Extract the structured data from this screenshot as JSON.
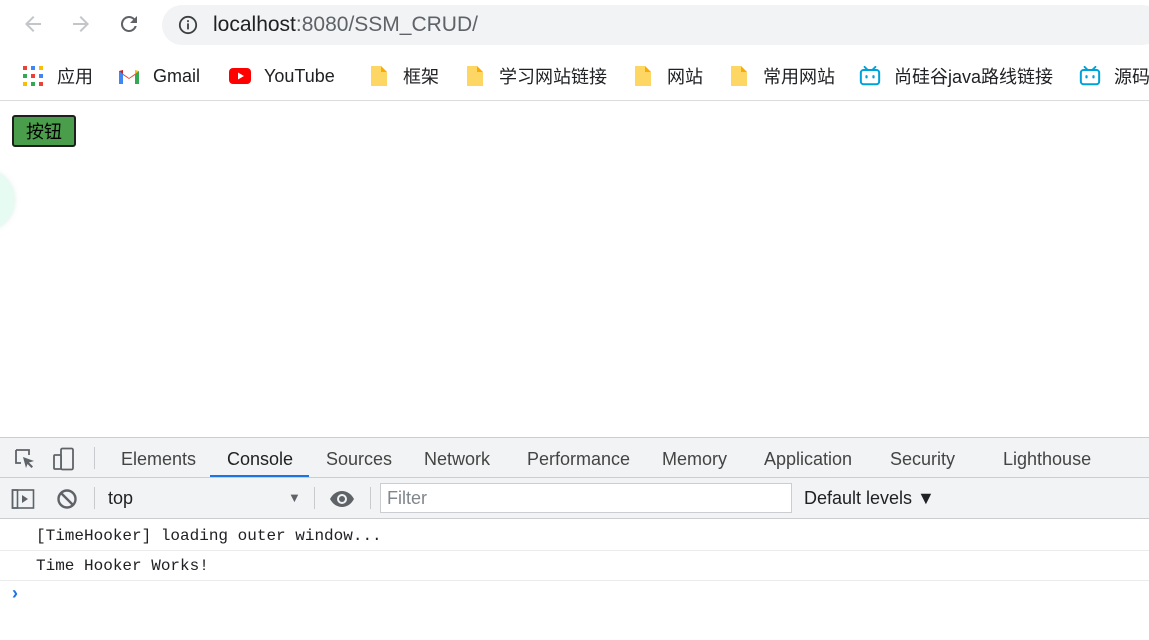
{
  "browser": {
    "url_host": "localhost",
    "url_rest": ":8080/SSM_CRUD/"
  },
  "bookmarks": [
    {
      "label": "应用",
      "icon": "apps-grid-icon"
    },
    {
      "label": "Gmail",
      "icon": "gmail-icon"
    },
    {
      "label": "YouTube",
      "icon": "youtube-icon"
    },
    {
      "label": "框架",
      "icon": "folder-icon"
    },
    {
      "label": "学习网站链接",
      "icon": "folder-icon"
    },
    {
      "label": "网站",
      "icon": "folder-icon"
    },
    {
      "label": "常用网站",
      "icon": "folder-icon"
    },
    {
      "label": "尚硅谷java路线链接",
      "icon": "bilibili-icon"
    },
    {
      "label": "源码",
      "icon": "bilibili-icon"
    }
  ],
  "page": {
    "button_label": "按钮"
  },
  "devtools": {
    "tabs": [
      "Elements",
      "Console",
      "Sources",
      "Network",
      "Performance",
      "Memory",
      "Application",
      "Security",
      "Lighthouse"
    ],
    "active_tab": "Console",
    "context": "top",
    "filter_placeholder": "Filter",
    "levels_label": "Default levels ▼",
    "logs": [
      "[TimeHooker] loading outer window...",
      "Time Hooker Works!"
    ],
    "prompt_symbol": "›"
  },
  "colors": {
    "page_button_bg": "#4a9d4a",
    "active_tab_underline": "#1a73e8",
    "youtube_red": "#ff0000",
    "folder_yellow": "#fdd663",
    "bilibili_blue": "#00a1d6"
  }
}
